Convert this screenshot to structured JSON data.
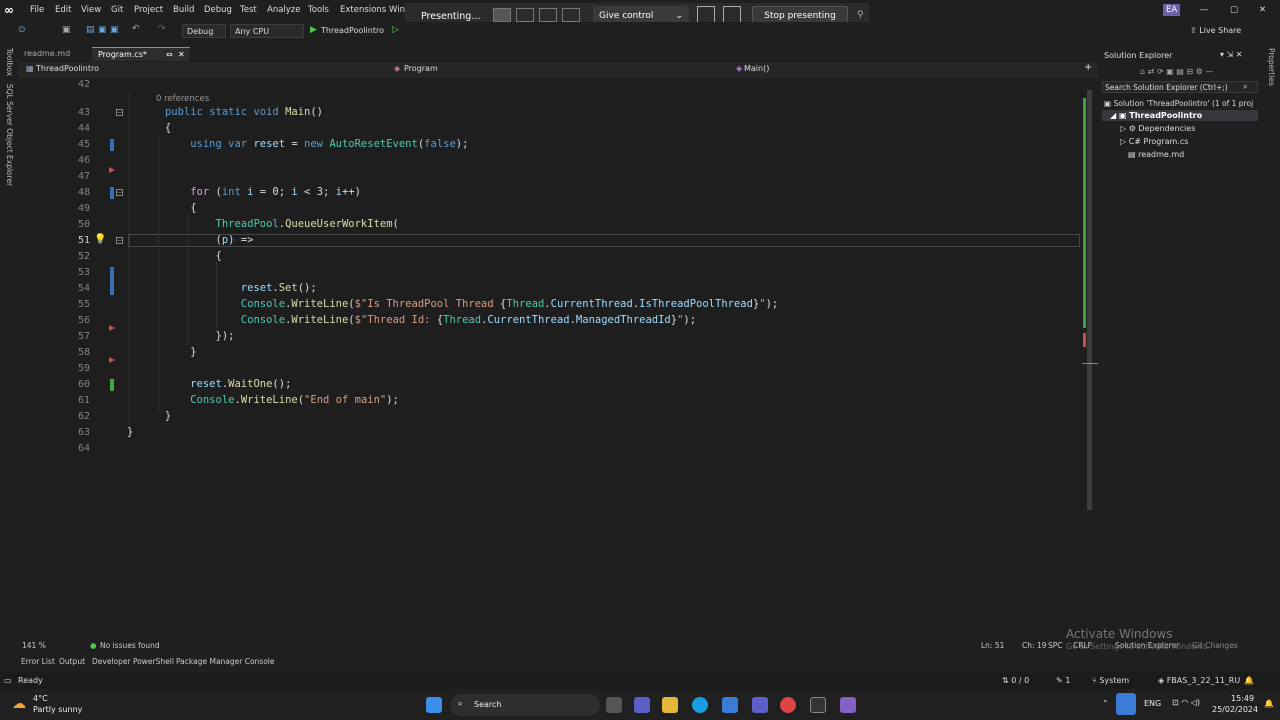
{
  "menubar": {
    "items": [
      "File",
      "Edit",
      "View",
      "Git",
      "Project",
      "Build",
      "Debug",
      "Test",
      "Analyze",
      "Tools",
      "Extensions",
      "Wind"
    ],
    "user_initials": "EA",
    "live_share": "Live Share"
  },
  "presenting": {
    "label": "Presenting...",
    "give_control": "Give control",
    "stop": "Stop presenting"
  },
  "toolbar": {
    "config": "Debug",
    "platform": "Any CPU",
    "run_target": "ThreadPoolintro"
  },
  "left_strip": {
    "toolbox": "Toolbox",
    "sql": "SQL Server Object Explorer"
  },
  "tabs": [
    {
      "label": "readme.md"
    },
    {
      "label": "Program.cs*"
    }
  ],
  "navbar": {
    "project": "ThreadPoolintro",
    "class": "Program",
    "member": "Main()"
  },
  "editor": {
    "references": "0 references",
    "line_numbers": [
      "42",
      "43",
      "44",
      "45",
      "46",
      "47",
      "48",
      "49",
      "50",
      "51",
      "52",
      "53",
      "54",
      "55",
      "56",
      "57",
      "58",
      "59",
      "60",
      "61",
      "62",
      "63",
      "64"
    ],
    "current_line": "51"
  },
  "solution_explorer": {
    "title": "Solution Explorer",
    "search": "Search Solution Explorer (Ctrl+;)",
    "solution": "Solution 'ThreadPoolintro' (1 of 1 proj",
    "project": "ThreadPoolintro",
    "dependencies": "Dependencies",
    "program": "Program.cs",
    "readme": "readme.md"
  },
  "right_strip": {
    "properties": "Properties"
  },
  "editor_status": {
    "zoom": "141 %",
    "issues": "No issues found",
    "line": "Ln: 51",
    "col": "Ch: 19",
    "spc": "SPC",
    "crlf": "CRLF",
    "sol_tab": "Solution Explorer",
    "git_tab": "Git Changes"
  },
  "bottom_tabs": [
    "Error List",
    "Output",
    "Developer PowerShell",
    "Package Manager Console"
  ],
  "statusbar": {
    "ready": "Ready",
    "counts": "0 / 0",
    "pencil": "1",
    "system": "System",
    "repo": "FBAS_3_22_11_RU"
  },
  "taskbar": {
    "temp": "4°C",
    "weather": "Partly sunny",
    "search": "Search",
    "lang": "ENG",
    "time": "15:49",
    "date": "25/02/2024"
  },
  "watermark": {
    "title": "Activate Windows",
    "sub": "Go to Settings to activate Windows."
  }
}
